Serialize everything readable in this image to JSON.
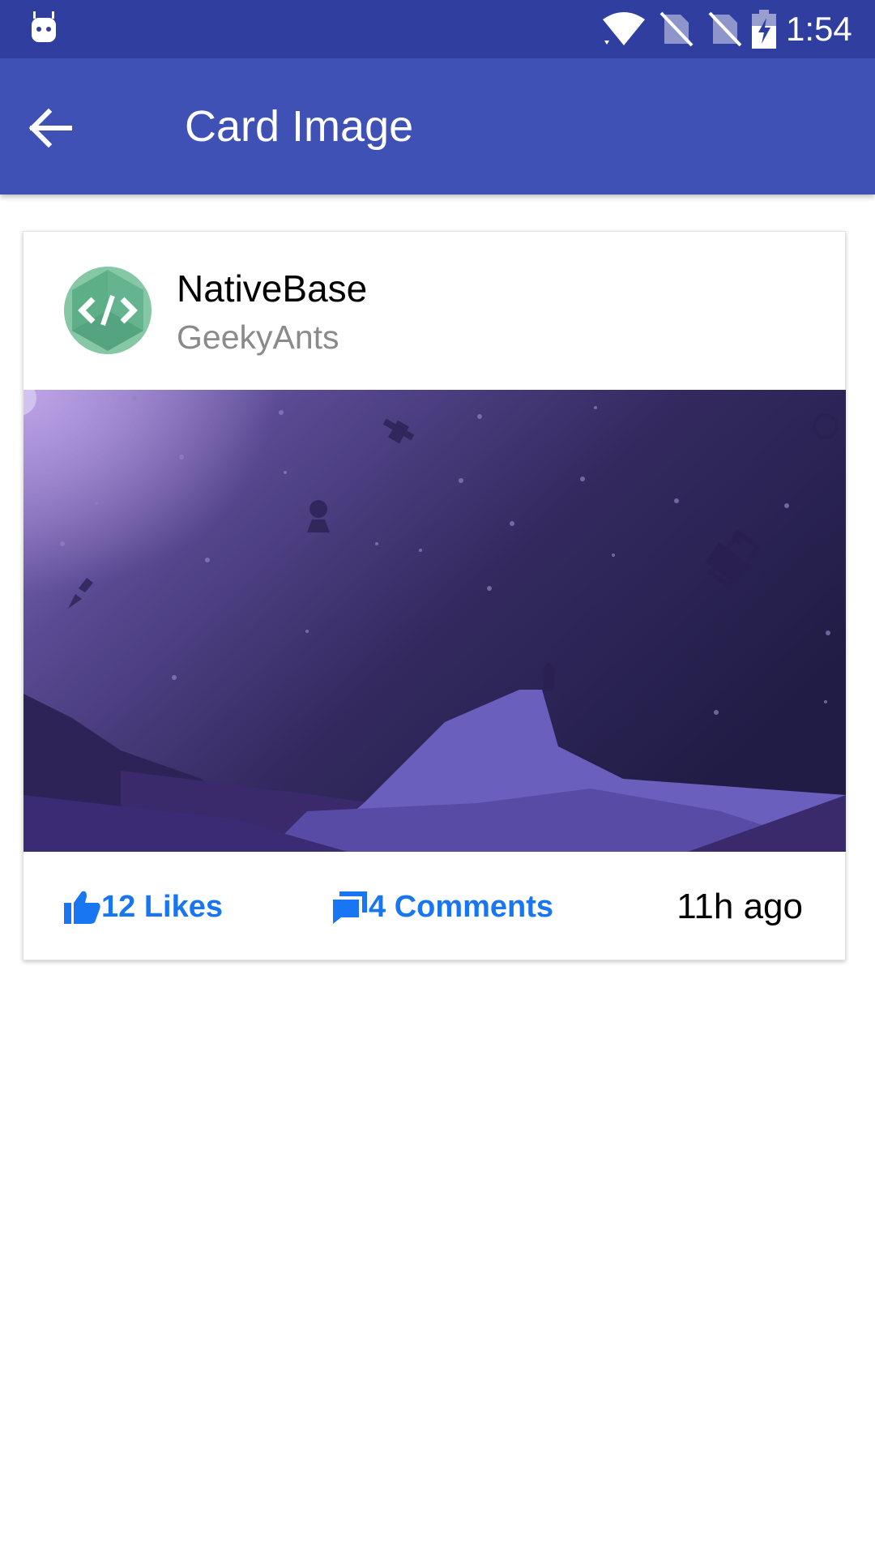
{
  "status_bar": {
    "time": "1:54",
    "icons": [
      "android-robot-icon",
      "wifi-icon",
      "no-sim-icon",
      "no-sim-icon",
      "battery-charging-icon"
    ]
  },
  "toolbar": {
    "title": "Card Image",
    "back_icon": "arrow-back-icon",
    "background_color": "#3F51B5",
    "status_color": "#303F9F"
  },
  "card": {
    "title": "NativeBase",
    "subtitle": "GeekyAnts",
    "avatar_icon": "code-brackets-icon",
    "image_icon": "space-mountain-illustration",
    "likes_label": "12 Likes",
    "comments_label": "4 Comments",
    "time_label": "11h ago",
    "accent_color": "#1976F2"
  }
}
